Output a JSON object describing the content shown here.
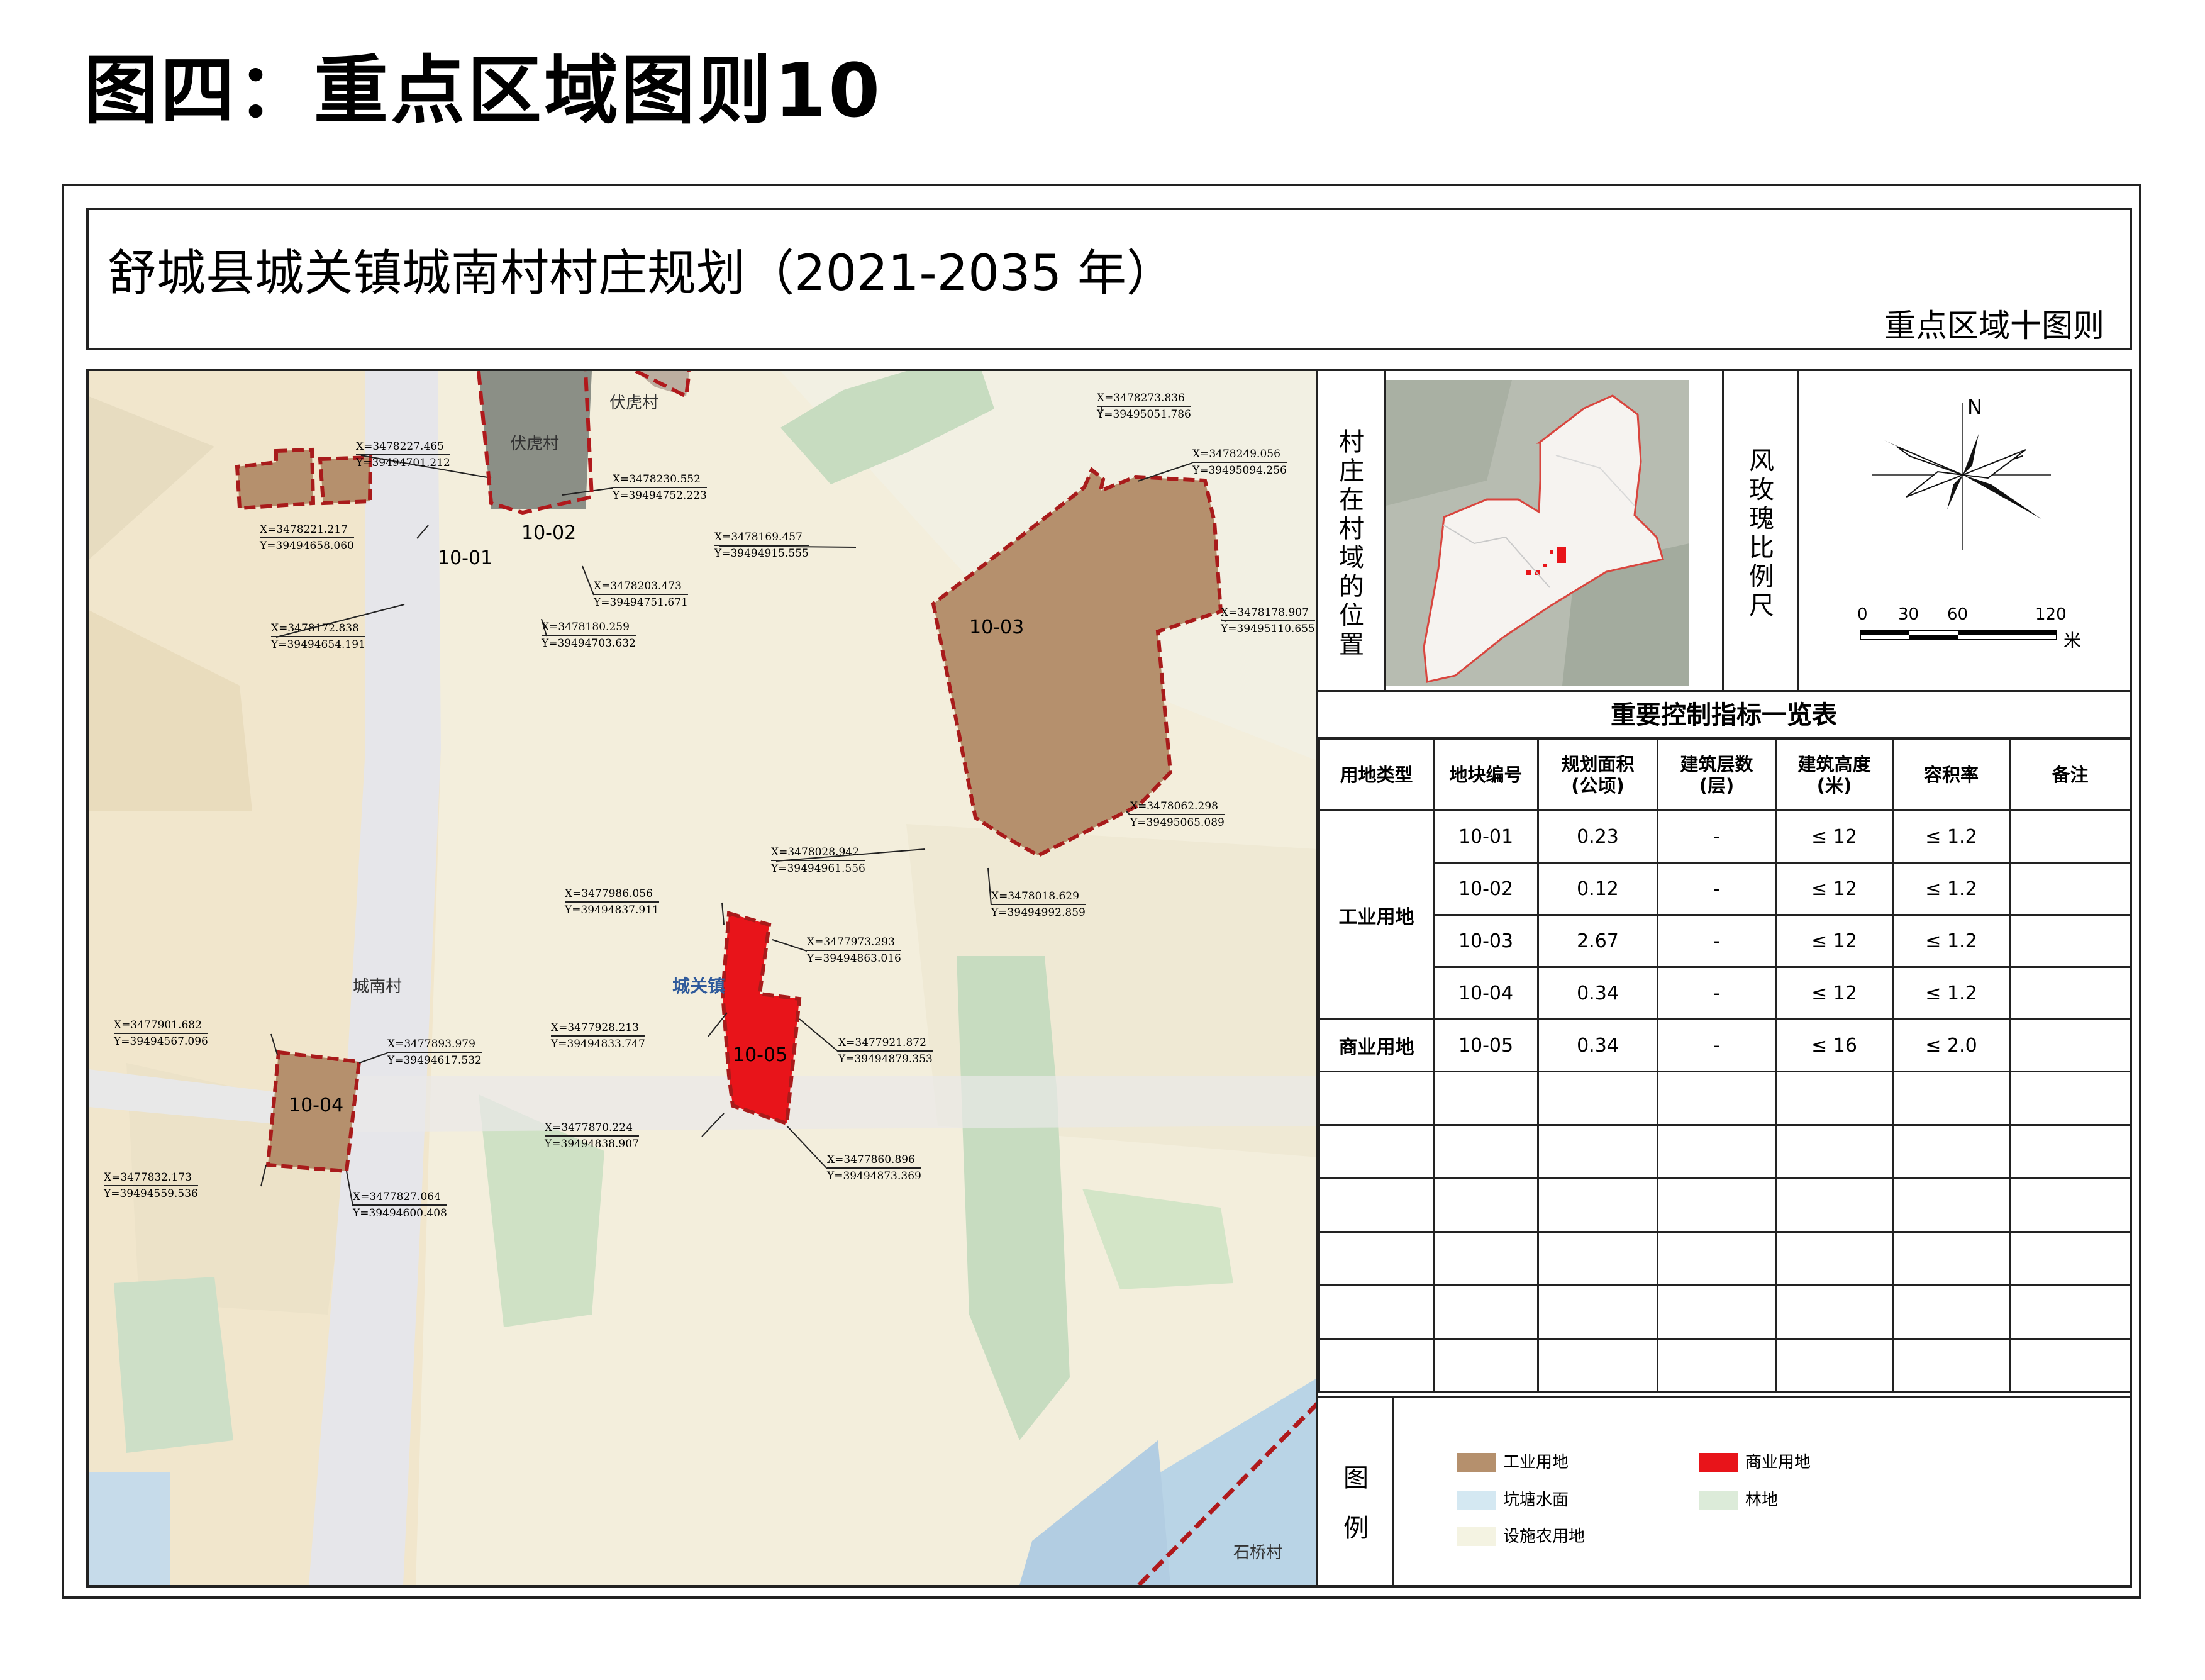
{
  "page_title": "图四：重点区域图则10",
  "plan_title": "舒城县城关镇城南村村庄规划（2021-2035 年）",
  "plan_subtitle": "重点区域十图则",
  "map": {
    "place_labels": [
      "伏虎村",
      "伏虎村",
      "城南村",
      "城关镇",
      "石桥村"
    ],
    "parcels": [
      {
        "id": "10-01",
        "use": "工业用地",
        "color": "#b5906d"
      },
      {
        "id": "10-02",
        "use": "工业用地",
        "color": "#b5906d"
      },
      {
        "id": "10-03",
        "use": "工业用地",
        "color": "#b5906d"
      },
      {
        "id": "10-04",
        "use": "工业用地",
        "color": "#b5906d"
      },
      {
        "id": "10-05",
        "use": "商业用地",
        "color": "#e8141a"
      }
    ],
    "coords": [
      [
        "X=3478227.465",
        "Y=39494701.212"
      ],
      [
        "X=3478230.552",
        "Y=39494752.223"
      ],
      [
        "X=3478221.217",
        "Y=39494658.060"
      ],
      [
        "X=3478203.473",
        "Y=39494751.671"
      ],
      [
        "X=3478172.838",
        "Y=39494654.191"
      ],
      [
        "X=3478180.259",
        "Y=39494703.632"
      ],
      [
        "X=3478273.836",
        "Y=39495051.786"
      ],
      [
        "X=3478249.056",
        "Y=39495094.256"
      ],
      [
        "X=3478169.457",
        "Y=39494915.555"
      ],
      [
        "X=3478178.907",
        "Y=39495110.655"
      ],
      [
        "X=3478062.298",
        "Y=39495065.089"
      ],
      [
        "X=3478028.942",
        "Y=39494961.556"
      ],
      [
        "X=3478018.629",
        "Y=39494992.859"
      ],
      [
        "X=3477986.056",
        "Y=39494837.911"
      ],
      [
        "X=3477973.293",
        "Y=39494863.016"
      ],
      [
        "X=3477928.213",
        "Y=39494833.747"
      ],
      [
        "X=3477921.872",
        "Y=39494879.353"
      ],
      [
        "X=3477901.682",
        "Y=39494567.096"
      ],
      [
        "X=3477893.979",
        "Y=39494617.532"
      ],
      [
        "X=3477870.224",
        "Y=39494838.907"
      ],
      [
        "X=3477860.896",
        "Y=39494873.369"
      ],
      [
        "X=3477832.173",
        "Y=39494559.536"
      ],
      [
        "X=3477827.064",
        "Y=39494600.408"
      ]
    ]
  },
  "location_panel": {
    "label": "村庄在村域的位置"
  },
  "rose_panel": {
    "label": "风玫瑰比例尺",
    "north": "N",
    "scale_ticks": [
      "0",
      "30",
      "60",
      "120"
    ],
    "scale_unit": "米"
  },
  "table": {
    "title": "重要控制指标一览表",
    "headers": [
      "用地类型",
      "地块编号",
      "规划面积\n(公顷)",
      "建筑层数\n(层)",
      "建筑高度\n(米)",
      "容积率",
      "备注"
    ],
    "groups": [
      {
        "type": "工业用地",
        "rows": [
          [
            "10-01",
            "0.23",
            "-",
            "≤ 12",
            "≤ 1.2",
            ""
          ],
          [
            "10-02",
            "0.12",
            "-",
            "≤ 12",
            "≤ 1.2",
            ""
          ],
          [
            "10-03",
            "2.67",
            "-",
            "≤ 12",
            "≤ 1.2",
            ""
          ],
          [
            "10-04",
            "0.34",
            "-",
            "≤ 12",
            "≤ 1.2",
            ""
          ]
        ]
      },
      {
        "type": "商业用地",
        "rows": [
          [
            "10-05",
            "0.34",
            "-",
            "≤ 16",
            "≤ 2.0",
            ""
          ]
        ]
      }
    ],
    "empty_rows": 6
  },
  "legend": {
    "label": "图例",
    "items": [
      {
        "name": "工业用地",
        "color": "#b5906d"
      },
      {
        "name": "商业用地",
        "color": "#e8141a"
      },
      {
        "name": "坑塘水面",
        "color": "#d4e8f2"
      },
      {
        "name": "林地",
        "color": "#dcebd9"
      },
      {
        "name": "设施农用地",
        "color": "#f4f3e2"
      }
    ]
  }
}
